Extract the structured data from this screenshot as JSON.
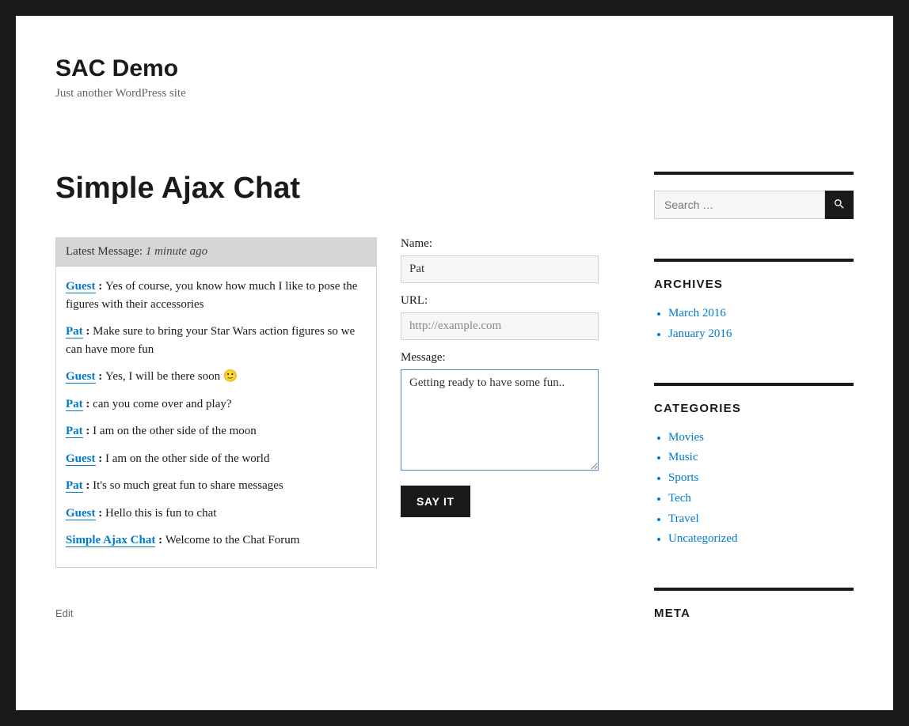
{
  "site": {
    "title": "SAC Demo",
    "tagline": "Just another WordPress site"
  },
  "page": {
    "title": "Simple Ajax Chat",
    "edit_label": "Edit"
  },
  "chat": {
    "latest_label": "Latest Message:",
    "latest_time": "1 minute ago",
    "messages": [
      {
        "user": "Guest",
        "text": "Yes of course, you know how much I like to pose the figures with their accessories"
      },
      {
        "user": "Pat",
        "text": "Make sure to bring your Star Wars action figures so we can have more fun"
      },
      {
        "user": "Guest",
        "text": "Yes, I will be there soon 🙂"
      },
      {
        "user": "Pat",
        "text": "can you come over and play?"
      },
      {
        "user": "Pat",
        "text": "I am on the other side of the moon"
      },
      {
        "user": "Guest",
        "text": "I am on the other side of the world"
      },
      {
        "user": "Pat",
        "text": "It's so much great fun to share messages"
      },
      {
        "user": "Guest",
        "text": "Hello this is fun to chat"
      },
      {
        "user": "Simple Ajax Chat",
        "text": "Welcome to the Chat Forum"
      }
    ]
  },
  "form": {
    "name_label": "Name:",
    "name_value": "Pat",
    "url_label": "URL:",
    "url_placeholder": "http://example.com",
    "message_label": "Message:",
    "message_value": "Getting ready to have some fun..",
    "submit_label": "Say It"
  },
  "sidebar": {
    "search_placeholder": "Search …",
    "archives_title": "Archives",
    "archives": [
      "March 2016",
      "January 2016"
    ],
    "categories_title": "Categories",
    "categories": [
      "Movies",
      "Music",
      "Sports",
      "Tech",
      "Travel",
      "Uncategorized"
    ],
    "meta_title": "Meta"
  }
}
